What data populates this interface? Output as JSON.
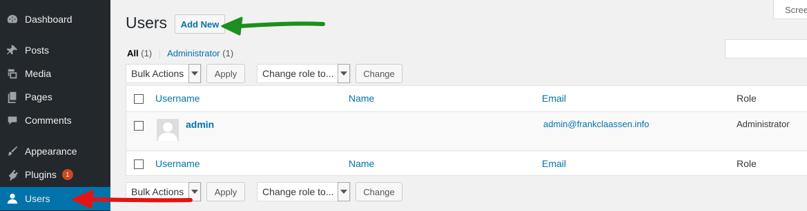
{
  "sidebar": {
    "items": [
      {
        "label": "Dashboard",
        "icon": "dashboard-icon"
      },
      {
        "label": "Posts",
        "icon": "pin-icon"
      },
      {
        "label": "Media",
        "icon": "media-icon"
      },
      {
        "label": "Pages",
        "icon": "pages-icon"
      },
      {
        "label": "Comments",
        "icon": "comment-icon"
      },
      {
        "label": "Appearance",
        "icon": "brush-icon"
      },
      {
        "label": "Plugins",
        "icon": "plugin-icon",
        "badge": "1"
      },
      {
        "label": "Users",
        "icon": "user-icon",
        "active": true
      }
    ]
  },
  "screen_options": {
    "label": "Scree"
  },
  "header": {
    "title": "Users",
    "add_new": "Add New"
  },
  "filters": {
    "all_label": "All",
    "all_count": "(1)",
    "separator": "|",
    "admin_label": "Administrator",
    "admin_count": "(1)"
  },
  "bulk": {
    "actions": "Bulk Actions",
    "apply": "Apply",
    "role_select": "Change role to...",
    "change": "Change"
  },
  "table": {
    "columns": {
      "username": "Username",
      "name": "Name",
      "email": "Email",
      "role": "Role"
    },
    "rows": [
      {
        "username": "admin",
        "name": "",
        "email": "admin@frankclaassen.info",
        "role": "Administrator"
      }
    ]
  },
  "colors": {
    "sidebar_bg": "#23282d",
    "active_bg": "#0073aa",
    "link": "#0073aa",
    "annotation_green": "#1e8f1e",
    "annotation_red": "#e31414"
  }
}
